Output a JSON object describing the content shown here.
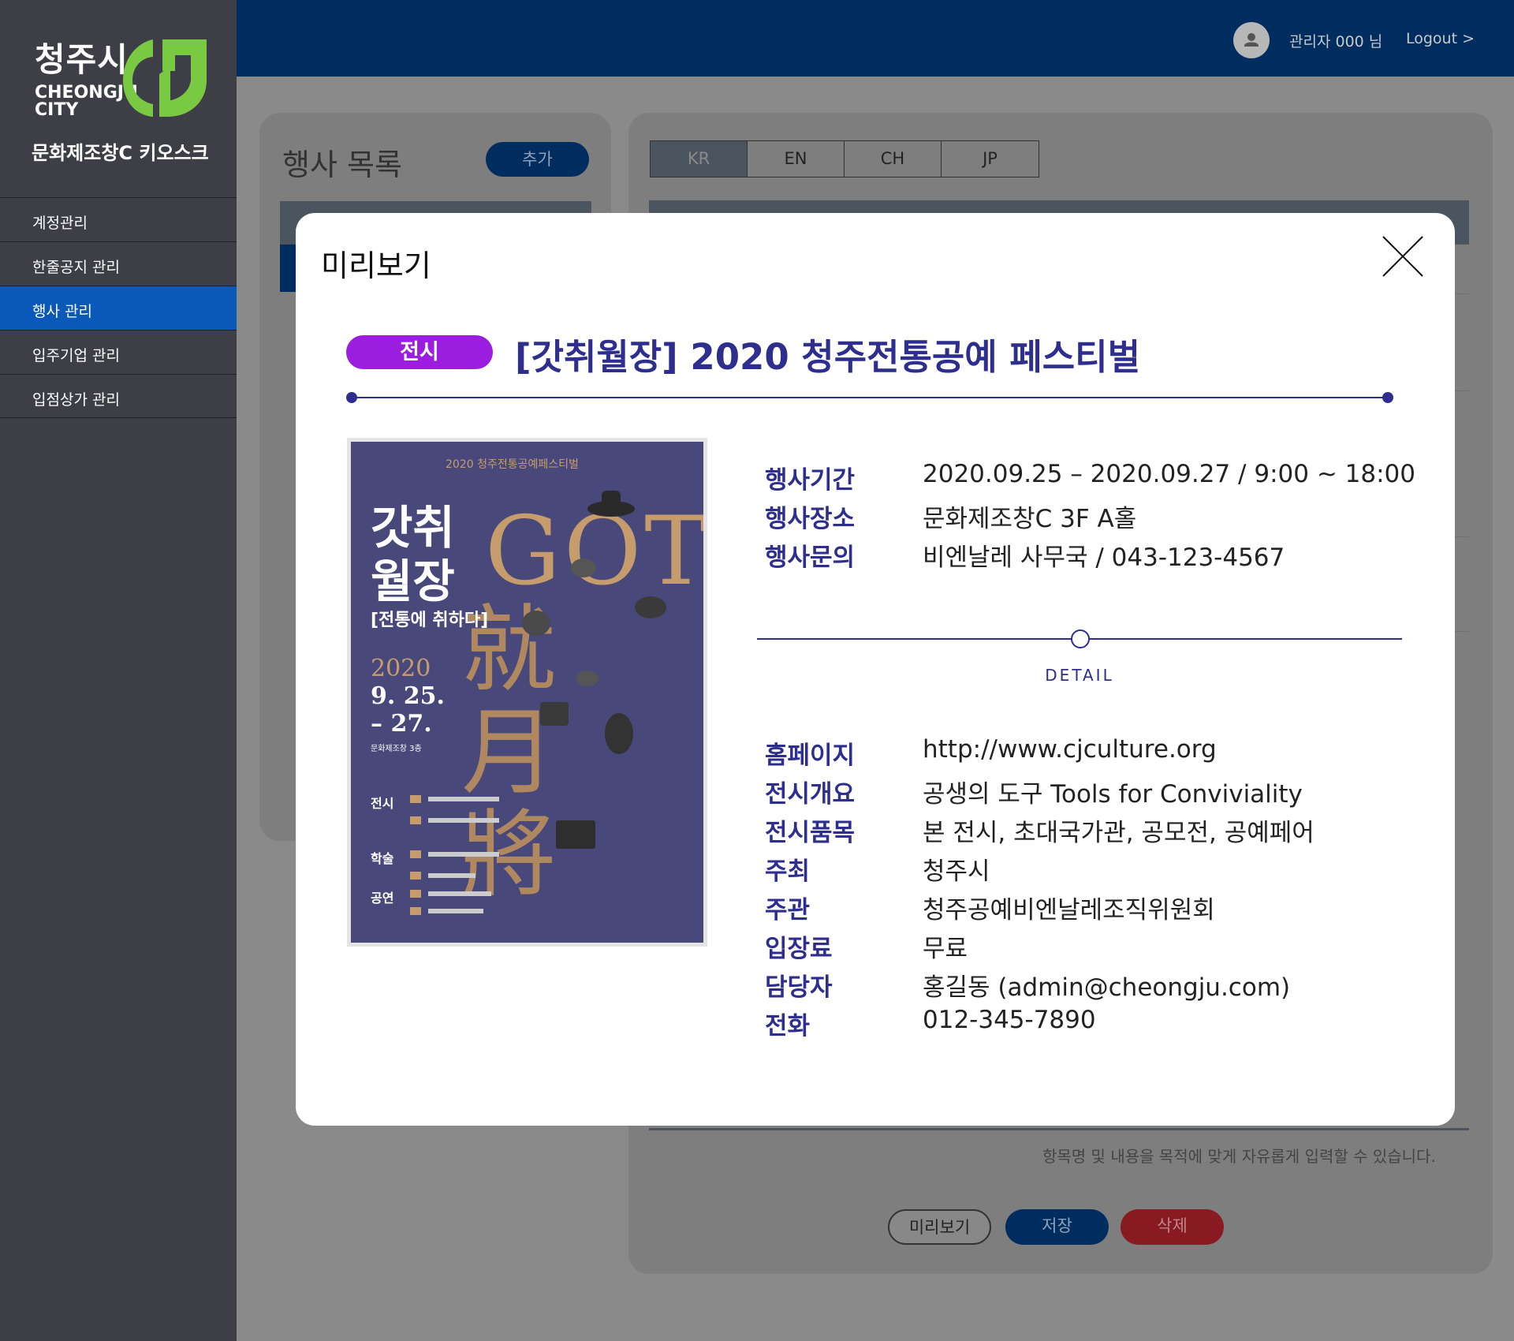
{
  "brand": {
    "logo_ko": "청주시",
    "logo_en_line1": "CHEONGJU",
    "logo_en_line2": "CITY",
    "kiosk_title": "문화제조창C 키오스크",
    "logo_color": "#7ac943"
  },
  "sidebar": {
    "items": [
      {
        "label": "계정관리"
      },
      {
        "label": "한줄공지 관리"
      },
      {
        "label": "행사 관리"
      },
      {
        "label": "입주기업 관리"
      },
      {
        "label": "입점상가 관리"
      }
    ],
    "active_index": 2,
    "active_color": "#0a59b8"
  },
  "topbar": {
    "admin_label": "관리자  000 님",
    "logout_label": "Logout  >",
    "avatar_icon": "user-icon"
  },
  "list_panel": {
    "title": "행사 목록",
    "add_label": "추가"
  },
  "form_panel": {
    "lang_tabs": [
      "KR",
      "EN",
      "CH",
      "JP"
    ],
    "active_tab": "KR",
    "helper_text": "항목명 및 내용을 목적에 맞게 자유롭게 입력할 수 있습니다.",
    "preview_label": "미리보기",
    "save_label": "저장",
    "delete_label": "삭제"
  },
  "modal": {
    "title": "미리보기",
    "close_icon": "close-icon",
    "category": "전시",
    "category_color": "#9b1ddf",
    "event_title": "[갓취월장] 2020 청주전통공예 페스티벌",
    "accent_color": "#2e2e8f",
    "info": [
      {
        "label": "행사기간",
        "value": "2020.09.25 – 2020.09.27 / 9:00 ~ 18:00"
      },
      {
        "label": "행사장소",
        "value": "문화제조창C 3F A홀"
      },
      {
        "label": "행사문의",
        "value": "비엔날레 사무국  /  043-123-4567"
      }
    ],
    "detail_label": "DETAIL",
    "details": [
      {
        "label": "홈페이지",
        "value": "http://www.cjculture.org"
      },
      {
        "label": "전시개요",
        "value": "공생의 도구 Tools for Conviviality"
      },
      {
        "label": "전시품목",
        "value": "본 전시, 초대국가관, 공모전, 공예페어"
      },
      {
        "label": "주최",
        "value": "청주시"
      },
      {
        "label": "주관",
        "value": "청주공예비엔날레조직위원회"
      },
      {
        "label": "입장료",
        "value": "무료"
      },
      {
        "label": "담당자",
        "value": "홍길동  (admin@cheongju.com)"
      },
      {
        "label": "전화",
        "value": "012-345-7890"
      }
    ],
    "poster": {
      "header": "2020 청주전통공예페스티벌",
      "title_line1": "갓취",
      "title_line2": "월장",
      "subtitle": "[전통에 취하다]",
      "year": "2020",
      "date_line1": "9. 25.",
      "date_line2": "– 27.",
      "venue": "문화제조창 3층",
      "sections": [
        "전시",
        "학술",
        "공연"
      ],
      "big_text": "GOT",
      "big_hanja": "就月將"
    }
  }
}
